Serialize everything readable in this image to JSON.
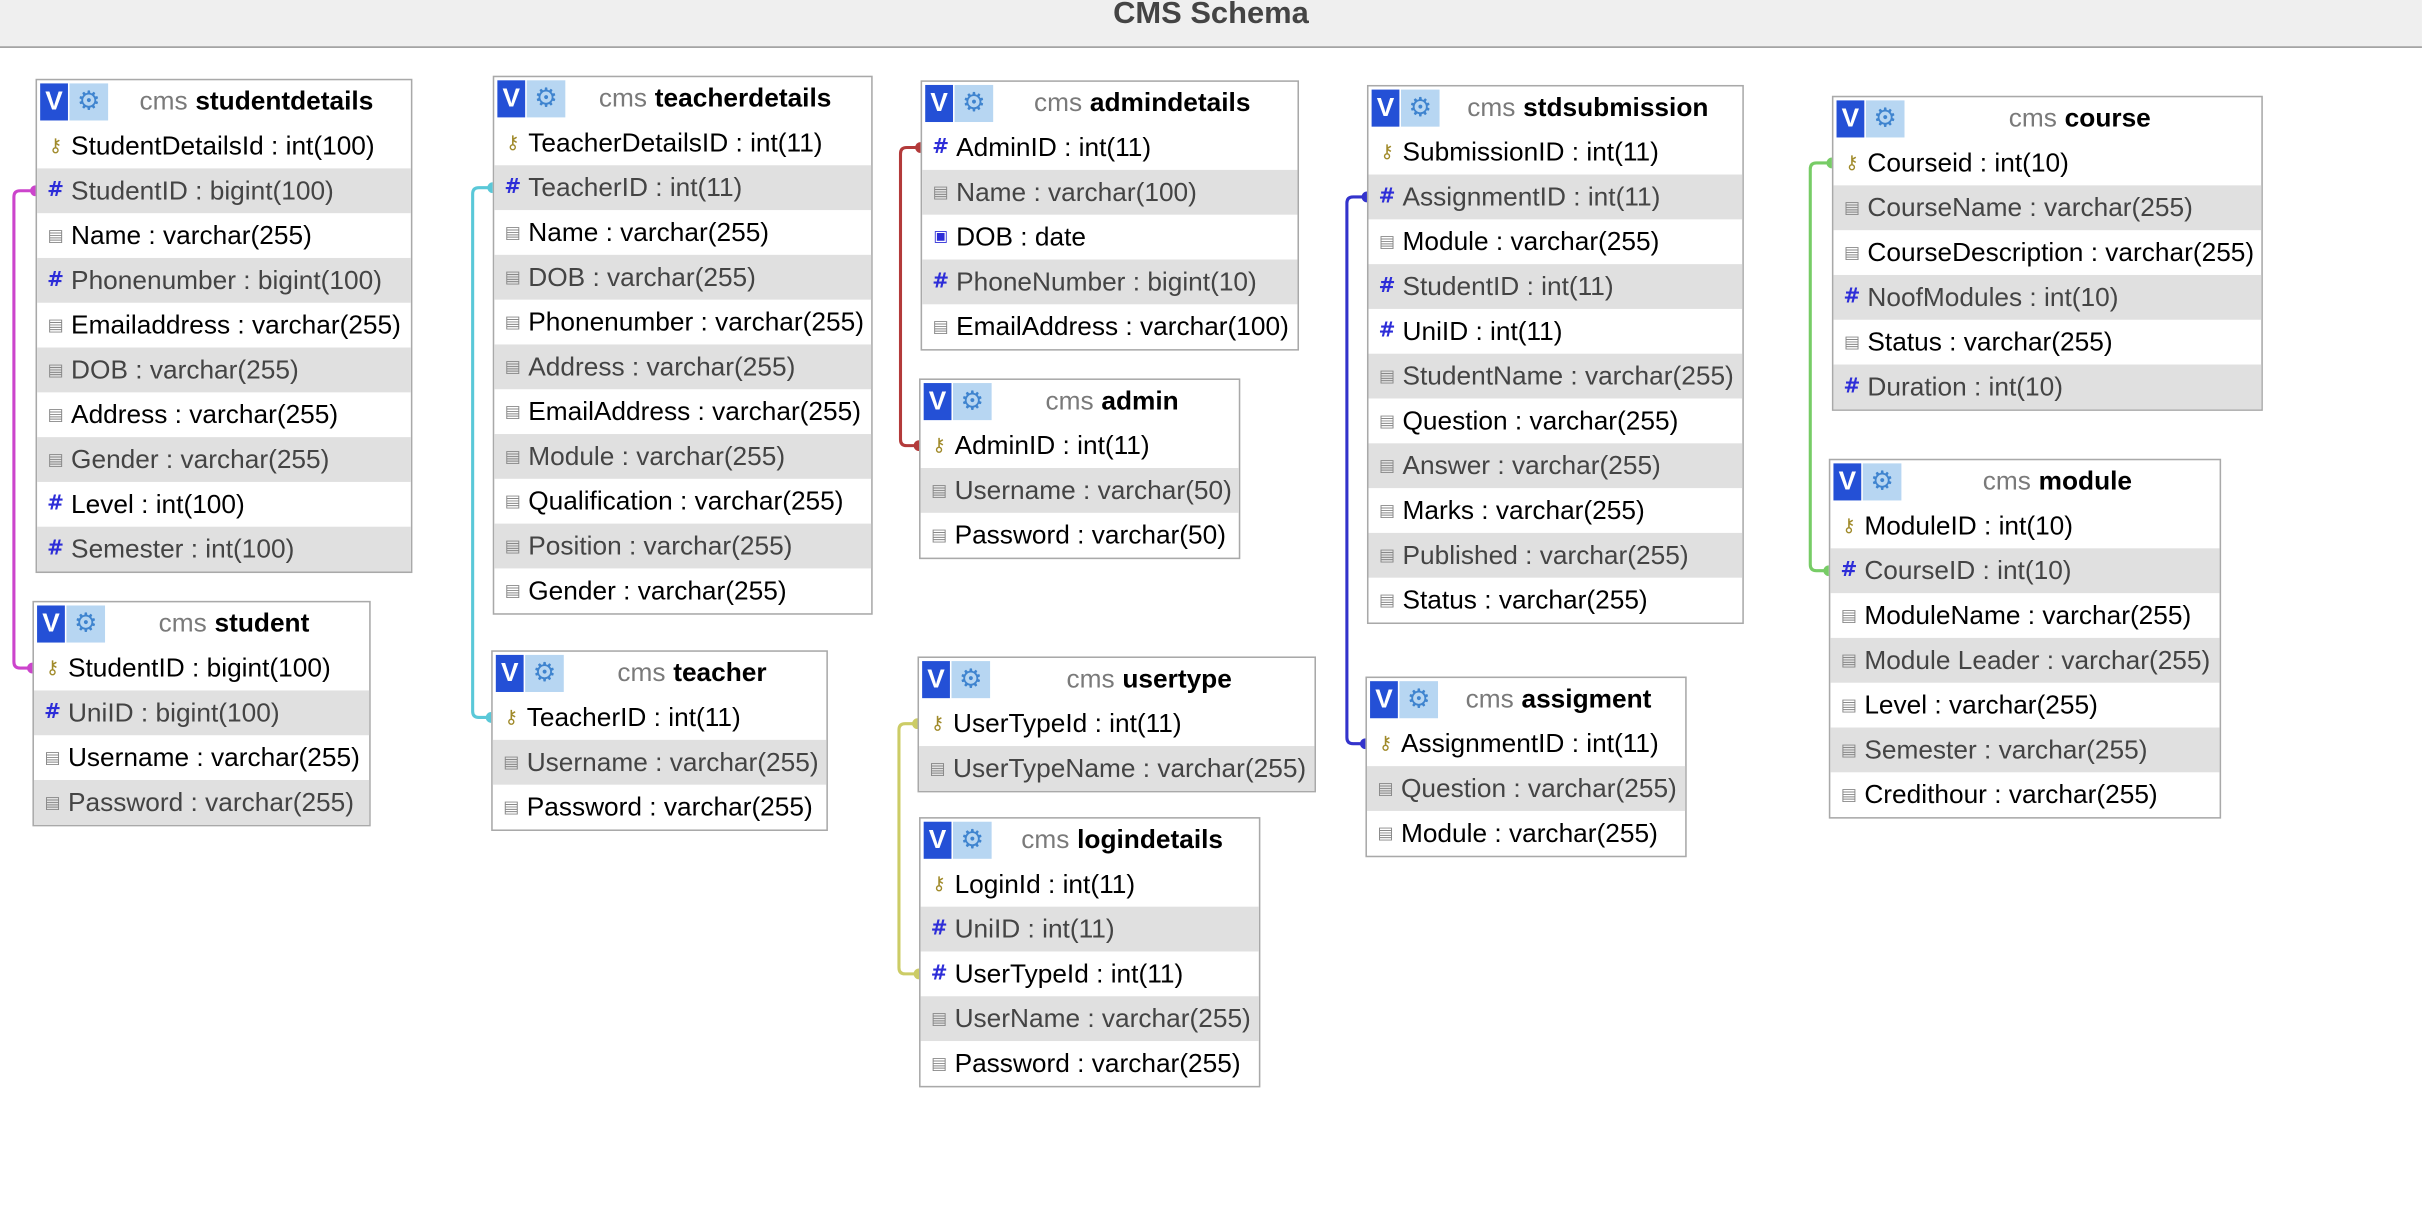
{
  "page_title": "CMS Schema",
  "icons": {
    "primary_key": "key-icon",
    "numeric": "hash-icon",
    "text": "text-field-icon",
    "date": "calendar-icon",
    "view_button": "v-button-icon",
    "options_button": "gear-icon"
  },
  "colors": {
    "titlebar_bg": "#efefef",
    "alt_row_bg": "#e0e0e0",
    "view_button": "#2450d6",
    "options_button": "#b7d6f2",
    "rel_student": "#cc44cc",
    "rel_teacher": "#5ac8d8",
    "rel_admin": "#b33a3a",
    "rel_usertype": "#cccc66",
    "rel_assignment": "#3333cc",
    "rel_course": "#77cc66"
  },
  "tables": [
    {
      "id": "studentdetails",
      "schema": "cms",
      "name": "studentdetails",
      "columns": [
        {
          "label": "StudentDetailsId : int(100)",
          "icon": "key"
        },
        {
          "label": "StudentID : bigint(100)",
          "icon": "hash",
          "index": true
        },
        {
          "label": "Name : varchar(255)",
          "icon": "txt"
        },
        {
          "label": "Phonenumber : bigint(100)",
          "icon": "hash",
          "index": true
        },
        {
          "label": "Emailaddress : varchar(255)",
          "icon": "txt"
        },
        {
          "label": "DOB : varchar(255)",
          "icon": "txt",
          "index": true
        },
        {
          "label": "Address : varchar(255)",
          "icon": "txt"
        },
        {
          "label": "Gender : varchar(255)",
          "icon": "txt",
          "index": true
        },
        {
          "label": "Level : int(100)",
          "icon": "hash"
        },
        {
          "label": "Semester : int(100)",
          "icon": "hash",
          "index": true
        }
      ]
    },
    {
      "id": "student",
      "schema": "cms",
      "name": "student",
      "columns": [
        {
          "label": "StudentID : bigint(100)",
          "icon": "key"
        },
        {
          "label": "UniID : bigint(100)",
          "icon": "hash",
          "index": true
        },
        {
          "label": "Username : varchar(255)",
          "icon": "txt"
        },
        {
          "label": "Password : varchar(255)",
          "icon": "txt",
          "index": true
        }
      ]
    },
    {
      "id": "teacherdetails",
      "schema": "cms",
      "name": "teacherdetails",
      "columns": [
        {
          "label": "TeacherDetailsID : int(11)",
          "icon": "key"
        },
        {
          "label": "TeacherID : int(11)",
          "icon": "hash",
          "index": true
        },
        {
          "label": "Name : varchar(255)",
          "icon": "txt"
        },
        {
          "label": "DOB : varchar(255)",
          "icon": "txt",
          "index": true
        },
        {
          "label": "Phonenumber : varchar(255)",
          "icon": "txt"
        },
        {
          "label": "Address : varchar(255)",
          "icon": "txt",
          "index": true
        },
        {
          "label": "EmailAddress : varchar(255)",
          "icon": "txt"
        },
        {
          "label": "Module : varchar(255)",
          "icon": "txt",
          "index": true
        },
        {
          "label": "Qualification : varchar(255)",
          "icon": "txt"
        },
        {
          "label": "Position : varchar(255)",
          "icon": "txt",
          "index": true
        },
        {
          "label": "Gender : varchar(255)",
          "icon": "txt"
        }
      ]
    },
    {
      "id": "teacher",
      "schema": "cms",
      "name": "teacher",
      "columns": [
        {
          "label": "TeacherID : int(11)",
          "icon": "key"
        },
        {
          "label": "Username : varchar(255)",
          "icon": "txt",
          "index": true
        },
        {
          "label": "Password : varchar(255)",
          "icon": "txt"
        }
      ]
    },
    {
      "id": "admindetails",
      "schema": "cms",
      "name": "admindetails",
      "columns": [
        {
          "label": "AdminID : int(11)",
          "icon": "hash"
        },
        {
          "label": "Name : varchar(100)",
          "icon": "txt",
          "index": true
        },
        {
          "label": "DOB : date",
          "icon": "cal"
        },
        {
          "label": "PhoneNumber : bigint(10)",
          "icon": "hash",
          "index": true
        },
        {
          "label": "EmailAddress : varchar(100)",
          "icon": "txt"
        }
      ]
    },
    {
      "id": "admin",
      "schema": "cms",
      "name": "admin",
      "columns": [
        {
          "label": "AdminID : int(11)",
          "icon": "key"
        },
        {
          "label": "Username : varchar(50)",
          "icon": "txt",
          "index": true
        },
        {
          "label": "Password : varchar(50)",
          "icon": "txt"
        }
      ]
    },
    {
      "id": "usertype",
      "schema": "cms",
      "name": "usertype",
      "columns": [
        {
          "label": "UserTypeId : int(11)",
          "icon": "key"
        },
        {
          "label": "UserTypeName : varchar(255)",
          "icon": "txt",
          "index": true
        }
      ]
    },
    {
      "id": "logindetails",
      "schema": "cms",
      "name": "logindetails",
      "columns": [
        {
          "label": "LoginId : int(11)",
          "icon": "key"
        },
        {
          "label": "UniID : int(11)",
          "icon": "hash",
          "index": true
        },
        {
          "label": "UserTypeId : int(11)",
          "icon": "hash"
        },
        {
          "label": "UserName : varchar(255)",
          "icon": "txt",
          "index": true
        },
        {
          "label": "Password : varchar(255)",
          "icon": "txt"
        }
      ]
    },
    {
      "id": "stdsubmission",
      "schema": "cms",
      "name": "stdsubmission",
      "columns": [
        {
          "label": "SubmissionID : int(11)",
          "icon": "key"
        },
        {
          "label": "AssignmentID : int(11)",
          "icon": "hash",
          "index": true
        },
        {
          "label": "Module : varchar(255)",
          "icon": "txt"
        },
        {
          "label": "StudentID : int(11)",
          "icon": "hash",
          "index": true
        },
        {
          "label": "UniID : int(11)",
          "icon": "hash"
        },
        {
          "label": "StudentName : varchar(255)",
          "icon": "txt",
          "index": true
        },
        {
          "label": "Question : varchar(255)",
          "icon": "txt"
        },
        {
          "label": "Answer : varchar(255)",
          "icon": "txt",
          "index": true
        },
        {
          "label": "Marks : varchar(255)",
          "icon": "txt"
        },
        {
          "label": "Published : varchar(255)",
          "icon": "txt",
          "index": true
        },
        {
          "label": "Status : varchar(255)",
          "icon": "txt"
        }
      ]
    },
    {
      "id": "assigment",
      "schema": "cms",
      "name": "assigment",
      "columns": [
        {
          "label": "AssignmentID : int(11)",
          "icon": "key"
        },
        {
          "label": "Question : varchar(255)",
          "icon": "txt",
          "index": true
        },
        {
          "label": "Module : varchar(255)",
          "icon": "txt"
        }
      ]
    },
    {
      "id": "course",
      "schema": "cms",
      "name": "course",
      "columns": [
        {
          "label": "Courseid : int(10)",
          "icon": "key"
        },
        {
          "label": "CourseName : varchar(255)",
          "icon": "txt",
          "index": true
        },
        {
          "label": "CourseDescription : varchar(255)",
          "icon": "txt"
        },
        {
          "label": "NoofModules : int(10)",
          "icon": "hash",
          "index": true
        },
        {
          "label": "Status : varchar(255)",
          "icon": "txt"
        },
        {
          "label": "Duration : int(10)",
          "icon": "hash",
          "index": true
        }
      ]
    },
    {
      "id": "module",
      "schema": "cms",
      "name": "module",
      "columns": [
        {
          "label": "ModuleID : int(10)",
          "icon": "key"
        },
        {
          "label": "CourseID : int(10)",
          "icon": "hash",
          "index": true
        },
        {
          "label": "ModuleName : varchar(255)",
          "icon": "txt"
        },
        {
          "label": "Module Leader : varchar(255)",
          "icon": "txt",
          "index": true
        },
        {
          "label": "Level : varchar(255)",
          "icon": "txt"
        },
        {
          "label": "Semester : varchar(255)",
          "icon": "txt",
          "index": true
        },
        {
          "label": "Credithour : varchar(255)",
          "icon": "txt"
        }
      ]
    }
  ],
  "relations": [
    {
      "from": "studentdetails",
      "from_row": 1,
      "to": "student",
      "to_row": 0,
      "color_key": "rel_student"
    },
    {
      "from": "teacherdetails",
      "from_row": 1,
      "to": "teacher",
      "to_row": 0,
      "color_key": "rel_teacher"
    },
    {
      "from": "admindetails",
      "from_row": 0,
      "to": "admin",
      "to_row": 0,
      "color_key": "rel_admin"
    },
    {
      "from": "logindetails",
      "from_row": 2,
      "to": "usertype",
      "to_row": 0,
      "color_key": "rel_usertype"
    },
    {
      "from": "stdsubmission",
      "from_row": 1,
      "to": "assigment",
      "to_row": 0,
      "color_key": "rel_assignment"
    },
    {
      "from": "module",
      "from_row": 1,
      "to": "course",
      "to_row": 0,
      "color_key": "rel_course"
    }
  ]
}
